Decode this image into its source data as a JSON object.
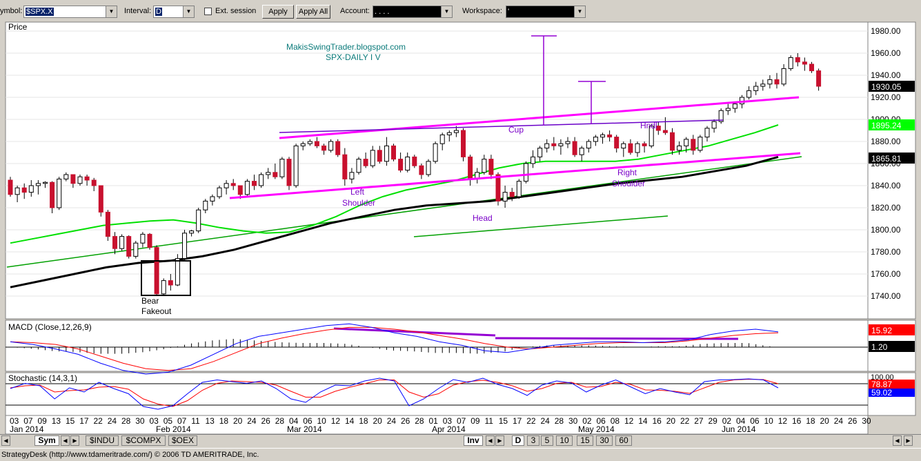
{
  "toolbar": {
    "symbol_label": "ymbol:",
    "symbol_value": "$SPX.X",
    "interval_label": "Interval:",
    "interval_value": "D",
    "ext_session_label": "Ext. session",
    "apply_label": "Apply",
    "apply_all_label": "Apply All",
    "account_label": "Account:",
    "account_value": ".   .   .   .",
    "workspace_label": "Workspace:",
    "workspace_value": "'"
  },
  "panels": {
    "price_title": "Price",
    "macd_title": "MACD (Close,12,26,9)",
    "stoch_title": "Stochastic (14,3,1)"
  },
  "annotations": {
    "blog": "MakisSwingTrader.blogspot.com",
    "subtitle": "SPX-DAILY  I V",
    "bear_fakeout_1": "Bear",
    "bear_fakeout_2": "Fakeout",
    "left_1": "Left",
    "left_2": "Shoulder",
    "head": "Head",
    "cup": "Cup",
    "handle": "Hndl",
    "right_1": "Right",
    "right_2": "Shoulder"
  },
  "tabs": {
    "sym": "Sym",
    "indu": "$INDU",
    "compx": "$COMPX",
    "oex": "$OEX",
    "inv": "Inv",
    "intervals": [
      "D",
      "3",
      "5",
      "10",
      "15",
      "30",
      "60"
    ]
  },
  "status_text": "StrategyDesk (http://www.tdameritrade.com/) © 2006 TD AMERITRADE, Inc.",
  "colors": {
    "up_candle": "#ffffff",
    "down_candle": "#c8102e",
    "ma_green": "#00e000",
    "ma_black": "#000000",
    "trend_magenta": "#ff00ff",
    "pattern_purple": "#9400d3",
    "macd_line": "#0000ff",
    "signal_line": "#ff0000",
    "stoch_k": "#0000ff",
    "stoch_d": "#ff0000"
  },
  "chart_data": {
    "type": "candlestick",
    "price_axis": {
      "ylim": [
        1725,
        1990
      ],
      "ticks": [
        "1980.00",
        "1960.00",
        "1940.00",
        "1920.00",
        "1900.00",
        "1880.00",
        "1860.00",
        "1840.00",
        "1820.00",
        "1800.00",
        "1780.00",
        "1760.00",
        "1740.00"
      ]
    },
    "price_labels": {
      "last": "1930.05",
      "ma50": "1895.24",
      "ma200": "1865.81"
    },
    "macd_labels": {
      "macd": "15.92",
      "signal": "1.20"
    },
    "stoch_labels": {
      "top": "100.00",
      "k": "78.87",
      "d": "59.02"
    },
    "date_ticks": [
      "03",
      "07",
      "09",
      "13",
      "15",
      "17",
      "22",
      "24",
      "28",
      "30",
      "03",
      "05",
      "07",
      "11",
      "13",
      "18",
      "20",
      "24",
      "26",
      "28",
      "04",
      "06",
      "10",
      "12",
      "14",
      "18",
      "20",
      "24",
      "26",
      "28",
      "01",
      "03",
      "07",
      "09",
      "11",
      "15",
      "17",
      "22",
      "24",
      "28",
      "30",
      "02",
      "06",
      "08",
      "12",
      "14",
      "16",
      "20",
      "22",
      "27",
      "29",
      "02",
      "04",
      "06",
      "10",
      "12",
      "16",
      "18",
      "20",
      "24",
      "26",
      "30"
    ],
    "month_labels": [
      "Jan 2014",
      "Feb 2014",
      "Mar 2014",
      "Apr 2014",
      "May 2014",
      "Jun 2014"
    ],
    "candles": [
      [
        1845,
        1848,
        1830,
        1832
      ],
      [
        1832,
        1840,
        1825,
        1838
      ],
      [
        1838,
        1842,
        1828,
        1834
      ],
      [
        1834,
        1845,
        1830,
        1840
      ],
      [
        1840,
        1845,
        1832,
        1842
      ],
      [
        1842,
        1844,
        1838,
        1843
      ],
      [
        1843,
        1844,
        1815,
        1820
      ],
      [
        1820,
        1848,
        1818,
        1846
      ],
      [
        1846,
        1852,
        1844,
        1850
      ],
      [
        1850,
        1850,
        1838,
        1842
      ],
      [
        1842,
        1850,
        1840,
        1848
      ],
      [
        1848,
        1850,
        1840,
        1845
      ],
      [
        1845,
        1847,
        1835,
        1840
      ],
      [
        1840,
        1840,
        1812,
        1816
      ],
      [
        1816,
        1818,
        1790,
        1794
      ],
      [
        1794,
        1798,
        1778,
        1783
      ],
      [
        1783,
        1796,
        1781,
        1794
      ],
      [
        1794,
        1795,
        1774,
        1776
      ],
      [
        1776,
        1790,
        1774,
        1788
      ],
      [
        1788,
        1798,
        1784,
        1796
      ],
      [
        1796,
        1797,
        1782,
        1784
      ],
      [
        1784,
        1786,
        1740,
        1742
      ],
      [
        1742,
        1756,
        1740,
        1754
      ],
      [
        1754,
        1760,
        1745,
        1750
      ],
      [
        1750,
        1778,
        1749,
        1774
      ],
      [
        1774,
        1800,
        1772,
        1797
      ],
      [
        1797,
        1800,
        1794,
        1799
      ],
      [
        1799,
        1820,
        1797,
        1818
      ],
      [
        1818,
        1828,
        1815,
        1826
      ],
      [
        1826,
        1832,
        1822,
        1830
      ],
      [
        1830,
        1840,
        1828,
        1838
      ],
      [
        1838,
        1845,
        1832,
        1842
      ],
      [
        1842,
        1846,
        1836,
        1840
      ],
      [
        1840,
        1840,
        1828,
        1832
      ],
      [
        1832,
        1846,
        1830,
        1844
      ],
      [
        1844,
        1850,
        1836,
        1840
      ],
      [
        1840,
        1852,
        1838,
        1850
      ],
      [
        1850,
        1856,
        1846,
        1852
      ],
      [
        1852,
        1860,
        1846,
        1848
      ],
      [
        1848,
        1866,
        1846,
        1864
      ],
      [
        1864,
        1866,
        1836,
        1840
      ],
      [
        1840,
        1878,
        1838,
        1876
      ],
      [
        1876,
        1880,
        1872,
        1878
      ],
      [
        1878,
        1882,
        1876,
        1880
      ],
      [
        1880,
        1884,
        1874,
        1876
      ],
      [
        1876,
        1878,
        1868,
        1872
      ],
      [
        1872,
        1882,
        1870,
        1880
      ],
      [
        1880,
        1882,
        1866,
        1868
      ],
      [
        1868,
        1874,
        1840,
        1846
      ],
      [
        1846,
        1856,
        1842,
        1852
      ],
      [
        1852,
        1866,
        1850,
        1864
      ],
      [
        1864,
        1870,
        1856,
        1858
      ],
      [
        1858,
        1876,
        1856,
        1872
      ],
      [
        1872,
        1876,
        1860,
        1862
      ],
      [
        1862,
        1884,
        1858,
        1876
      ],
      [
        1876,
        1878,
        1862,
        1864
      ],
      [
        1864,
        1870,
        1852,
        1854
      ],
      [
        1854,
        1870,
        1852,
        1866
      ],
      [
        1866,
        1868,
        1856,
        1858
      ],
      [
        1858,
        1860,
        1846,
        1850
      ],
      [
        1850,
        1864,
        1848,
        1862
      ],
      [
        1862,
        1880,
        1860,
        1878
      ],
      [
        1878,
        1888,
        1872,
        1886
      ],
      [
        1886,
        1890,
        1880,
        1888
      ],
      [
        1888,
        1894,
        1884,
        1890
      ],
      [
        1890,
        1892,
        1862,
        1866
      ],
      [
        1866,
        1868,
        1840,
        1846
      ],
      [
        1846,
        1856,
        1842,
        1852
      ],
      [
        1852,
        1868,
        1850,
        1864
      ],
      [
        1864,
        1868,
        1846,
        1850
      ],
      [
        1850,
        1852,
        1822,
        1826
      ],
      [
        1826,
        1840,
        1820,
        1834
      ],
      [
        1834,
        1838,
        1826,
        1830
      ],
      [
        1830,
        1846,
        1828,
        1844
      ],
      [
        1844,
        1862,
        1842,
        1860
      ],
      [
        1860,
        1872,
        1856,
        1866
      ],
      [
        1866,
        1876,
        1862,
        1874
      ],
      [
        1874,
        1882,
        1870,
        1878
      ],
      [
        1878,
        1884,
        1872,
        1876
      ],
      [
        1876,
        1882,
        1868,
        1878
      ],
      [
        1878,
        1884,
        1874,
        1880
      ],
      [
        1880,
        1884,
        1866,
        1868
      ],
      [
        1868,
        1876,
        1862,
        1874
      ],
      [
        1874,
        1882,
        1870,
        1880
      ],
      [
        1880,
        1886,
        1876,
        1884
      ],
      [
        1884,
        1888,
        1878,
        1886
      ],
      [
        1886,
        1890,
        1880,
        1884
      ],
      [
        1884,
        1886,
        1870,
        1874
      ],
      [
        1874,
        1880,
        1866,
        1878
      ],
      [
        1878,
        1882,
        1868,
        1870
      ],
      [
        1870,
        1880,
        1866,
        1878
      ],
      [
        1878,
        1880,
        1870,
        1876
      ],
      [
        1876,
        1896,
        1874,
        1894
      ],
      [
        1894,
        1898,
        1886,
        1890
      ],
      [
        1890,
        1902,
        1886,
        1888
      ],
      [
        1888,
        1892,
        1868,
        1872
      ],
      [
        1872,
        1880,
        1868,
        1876
      ],
      [
        1876,
        1884,
        1870,
        1882
      ],
      [
        1882,
        1886,
        1868,
        1872
      ],
      [
        1872,
        1886,
        1870,
        1884
      ],
      [
        1884,
        1894,
        1880,
        1892
      ],
      [
        1892,
        1900,
        1888,
        1898
      ],
      [
        1898,
        1910,
        1896,
        1908
      ],
      [
        1908,
        1914,
        1904,
        1910
      ],
      [
        1910,
        1916,
        1906,
        1914
      ],
      [
        1914,
        1922,
        1910,
        1920
      ],
      [
        1920,
        1930,
        1918,
        1926
      ],
      [
        1926,
        1934,
        1922,
        1930
      ],
      [
        1930,
        1936,
        1926,
        1932
      ],
      [
        1932,
        1940,
        1928,
        1936
      ],
      [
        1936,
        1942,
        1928,
        1932
      ],
      [
        1932,
        1950,
        1930,
        1946
      ],
      [
        1946,
        1958,
        1944,
        1956
      ],
      [
        1956,
        1960,
        1948,
        1952
      ],
      [
        1952,
        1956,
        1944,
        1950
      ],
      [
        1950,
        1952,
        1942,
        1944
      ],
      [
        1944,
        1946,
        1926,
        1930
      ]
    ],
    "ma50": [
      1788,
      1792,
      1796,
      1800,
      1804,
      1806,
      1808,
      1809,
      1806,
      1802,
      1799,
      1797,
      1798,
      1804,
      1812,
      1822,
      1830,
      1836,
      1840,
      1844,
      1850,
      1856,
      1860,
      1862,
      1862,
      1862,
      1862,
      1864,
      1868,
      1872,
      1876,
      1882,
      1888,
      1895
    ],
    "ma200": [
      1748,
      1754,
      1760,
      1766,
      1770,
      1772,
      1776,
      1782,
      1790,
      1798,
      1806,
      1812,
      1818,
      1822,
      1824,
      1826,
      1830,
      1834,
      1838,
      1842,
      1845,
      1848,
      1853,
      1858,
      1866
    ],
    "macd": [
      6,
      3,
      -2,
      -8,
      -18,
      -26,
      -30,
      -28,
      -20,
      -8,
      4,
      12,
      16,
      20,
      24,
      26,
      22,
      16,
      12,
      6,
      2,
      -4,
      -6,
      -2,
      2,
      4,
      6,
      6,
      5,
      6,
      8,
      14,
      18,
      20,
      17
    ],
    "macd_signal": [
      6,
      5,
      3,
      -2,
      -10,
      -18,
      -24,
      -26,
      -24,
      -16,
      -6,
      4,
      10,
      15,
      19,
      22,
      22,
      20,
      17,
      13,
      9,
      4,
      0,
      -2,
      0,
      2,
      4,
      5,
      5,
      5,
      7,
      10,
      13,
      15,
      16
    ],
    "stoch_k": [
      70,
      85,
      78,
      40,
      72,
      60,
      88,
      70,
      55,
      18,
      10,
      20,
      55,
      88,
      95,
      90,
      85,
      92,
      70,
      40,
      30,
      60,
      80,
      78,
      92,
      100,
      92,
      20,
      40,
      70,
      96,
      88,
      100,
      82,
      70,
      50,
      80,
      92,
      86,
      60,
      80,
      95,
      75,
      55,
      70,
      60,
      52,
      90,
      95,
      96,
      98,
      95,
      72
    ],
    "stoch_d": [
      72,
      78,
      80,
      60,
      64,
      66,
      74,
      76,
      68,
      40,
      25,
      18,
      35,
      65,
      85,
      92,
      90,
      88,
      80,
      62,
      45,
      45,
      62,
      74,
      84,
      95,
      95,
      60,
      45,
      55,
      80,
      90,
      94,
      88,
      78,
      62,
      70,
      85,
      88,
      74,
      76,
      88,
      82,
      66,
      65,
      62,
      56,
      72,
      88,
      95,
      97,
      96,
      84
    ]
  }
}
